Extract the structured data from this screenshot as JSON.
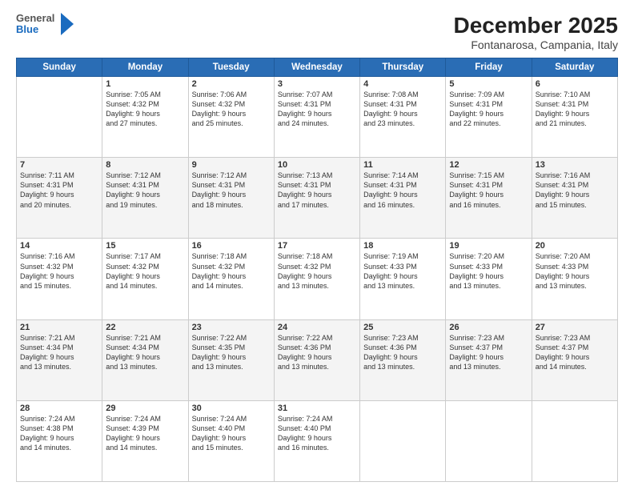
{
  "logo": {
    "general": "General",
    "blue": "Blue"
  },
  "title": "December 2025",
  "subtitle": "Fontanarosa, Campania, Italy",
  "headers": [
    "Sunday",
    "Monday",
    "Tuesday",
    "Wednesday",
    "Thursday",
    "Friday",
    "Saturday"
  ],
  "weeks": [
    [
      {
        "day": "",
        "info": ""
      },
      {
        "day": "1",
        "info": "Sunrise: 7:05 AM\nSunset: 4:32 PM\nDaylight: 9 hours\nand 27 minutes."
      },
      {
        "day": "2",
        "info": "Sunrise: 7:06 AM\nSunset: 4:32 PM\nDaylight: 9 hours\nand 25 minutes."
      },
      {
        "day": "3",
        "info": "Sunrise: 7:07 AM\nSunset: 4:31 PM\nDaylight: 9 hours\nand 24 minutes."
      },
      {
        "day": "4",
        "info": "Sunrise: 7:08 AM\nSunset: 4:31 PM\nDaylight: 9 hours\nand 23 minutes."
      },
      {
        "day": "5",
        "info": "Sunrise: 7:09 AM\nSunset: 4:31 PM\nDaylight: 9 hours\nand 22 minutes."
      },
      {
        "day": "6",
        "info": "Sunrise: 7:10 AM\nSunset: 4:31 PM\nDaylight: 9 hours\nand 21 minutes."
      }
    ],
    [
      {
        "day": "7",
        "info": "Sunrise: 7:11 AM\nSunset: 4:31 PM\nDaylight: 9 hours\nand 20 minutes."
      },
      {
        "day": "8",
        "info": "Sunrise: 7:12 AM\nSunset: 4:31 PM\nDaylight: 9 hours\nand 19 minutes."
      },
      {
        "day": "9",
        "info": "Sunrise: 7:12 AM\nSunset: 4:31 PM\nDaylight: 9 hours\nand 18 minutes."
      },
      {
        "day": "10",
        "info": "Sunrise: 7:13 AM\nSunset: 4:31 PM\nDaylight: 9 hours\nand 17 minutes."
      },
      {
        "day": "11",
        "info": "Sunrise: 7:14 AM\nSunset: 4:31 PM\nDaylight: 9 hours\nand 16 minutes."
      },
      {
        "day": "12",
        "info": "Sunrise: 7:15 AM\nSunset: 4:31 PM\nDaylight: 9 hours\nand 16 minutes."
      },
      {
        "day": "13",
        "info": "Sunrise: 7:16 AM\nSunset: 4:31 PM\nDaylight: 9 hours\nand 15 minutes."
      }
    ],
    [
      {
        "day": "14",
        "info": "Sunrise: 7:16 AM\nSunset: 4:32 PM\nDaylight: 9 hours\nand 15 minutes."
      },
      {
        "day": "15",
        "info": "Sunrise: 7:17 AM\nSunset: 4:32 PM\nDaylight: 9 hours\nand 14 minutes."
      },
      {
        "day": "16",
        "info": "Sunrise: 7:18 AM\nSunset: 4:32 PM\nDaylight: 9 hours\nand 14 minutes."
      },
      {
        "day": "17",
        "info": "Sunrise: 7:18 AM\nSunset: 4:32 PM\nDaylight: 9 hours\nand 13 minutes."
      },
      {
        "day": "18",
        "info": "Sunrise: 7:19 AM\nSunset: 4:33 PM\nDaylight: 9 hours\nand 13 minutes."
      },
      {
        "day": "19",
        "info": "Sunrise: 7:20 AM\nSunset: 4:33 PM\nDaylight: 9 hours\nand 13 minutes."
      },
      {
        "day": "20",
        "info": "Sunrise: 7:20 AM\nSunset: 4:33 PM\nDaylight: 9 hours\nand 13 minutes."
      }
    ],
    [
      {
        "day": "21",
        "info": "Sunrise: 7:21 AM\nSunset: 4:34 PM\nDaylight: 9 hours\nand 13 minutes."
      },
      {
        "day": "22",
        "info": "Sunrise: 7:21 AM\nSunset: 4:34 PM\nDaylight: 9 hours\nand 13 minutes."
      },
      {
        "day": "23",
        "info": "Sunrise: 7:22 AM\nSunset: 4:35 PM\nDaylight: 9 hours\nand 13 minutes."
      },
      {
        "day": "24",
        "info": "Sunrise: 7:22 AM\nSunset: 4:36 PM\nDaylight: 9 hours\nand 13 minutes."
      },
      {
        "day": "25",
        "info": "Sunrise: 7:23 AM\nSunset: 4:36 PM\nDaylight: 9 hours\nand 13 minutes."
      },
      {
        "day": "26",
        "info": "Sunrise: 7:23 AM\nSunset: 4:37 PM\nDaylight: 9 hours\nand 13 minutes."
      },
      {
        "day": "27",
        "info": "Sunrise: 7:23 AM\nSunset: 4:37 PM\nDaylight: 9 hours\nand 14 minutes."
      }
    ],
    [
      {
        "day": "28",
        "info": "Sunrise: 7:24 AM\nSunset: 4:38 PM\nDaylight: 9 hours\nand 14 minutes."
      },
      {
        "day": "29",
        "info": "Sunrise: 7:24 AM\nSunset: 4:39 PM\nDaylight: 9 hours\nand 14 minutes."
      },
      {
        "day": "30",
        "info": "Sunrise: 7:24 AM\nSunset: 4:40 PM\nDaylight: 9 hours\nand 15 minutes."
      },
      {
        "day": "31",
        "info": "Sunrise: 7:24 AM\nSunset: 4:40 PM\nDaylight: 9 hours\nand 16 minutes."
      },
      {
        "day": "",
        "info": ""
      },
      {
        "day": "",
        "info": ""
      },
      {
        "day": "",
        "info": ""
      }
    ]
  ]
}
